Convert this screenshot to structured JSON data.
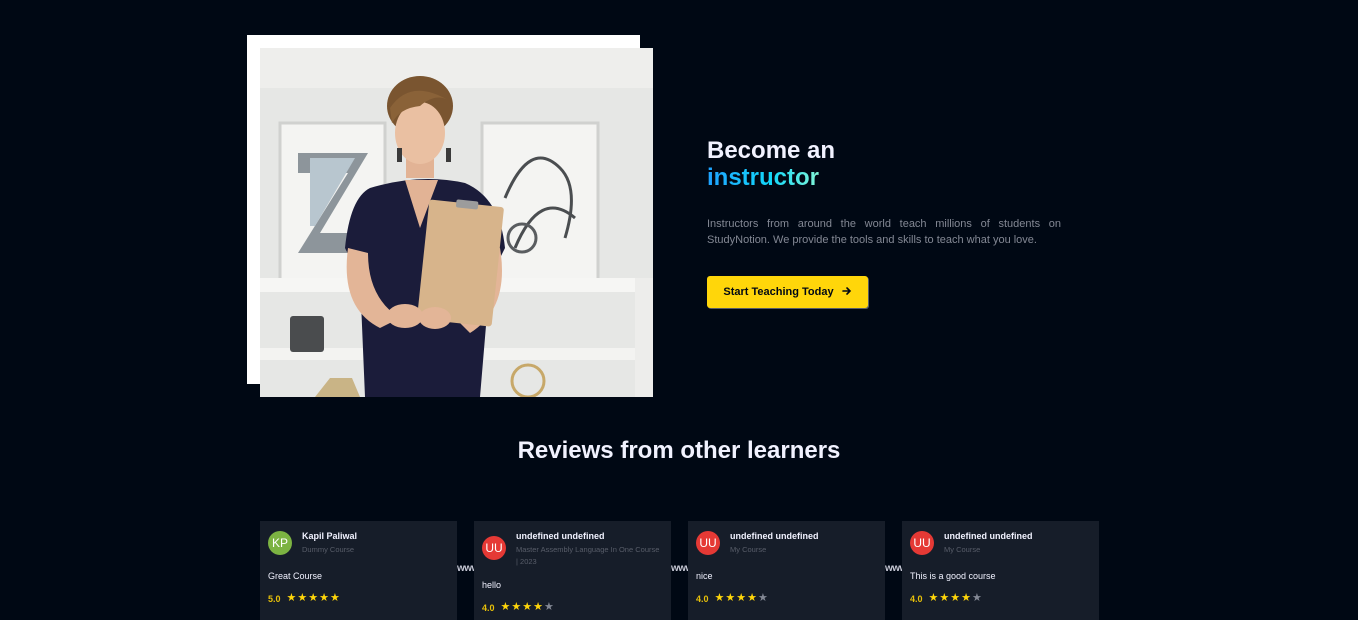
{
  "instructor": {
    "title_line1": "Become an",
    "title_line2": "instructor",
    "description": "Instructors from around the world teach millions of students on StudyNotion. We provide the tools and skills to teach what you love.",
    "cta_label": "Start Teaching Today",
    "cta_icon": "arrow-right-icon",
    "accent_color": "#ffd60a"
  },
  "reviews": {
    "title": "Reviews from other learners",
    "separator_text": "www",
    "items": [
      {
        "initials": "KP",
        "avatar_color": "#7cb342",
        "name": "Kapil Paliwal",
        "course": "Dummy Course",
        "text": "Great Course",
        "score": "5.0",
        "stars": 5
      },
      {
        "initials": "UU",
        "avatar_color": "#e53935",
        "name": "undefined undefined",
        "course": "Master Assembly Language In One Course | 2023",
        "text": "hello",
        "score": "4.0",
        "stars": 4
      },
      {
        "initials": "UU",
        "avatar_color": "#e53935",
        "name": "undefined undefined",
        "course": "My Course",
        "text": "nice",
        "score": "4.0",
        "stars": 4
      },
      {
        "initials": "UU",
        "avatar_color": "#e53935",
        "name": "undefined undefined",
        "course": "My Course",
        "text": "This is a good course",
        "score": "4.0",
        "stars": 4
      }
    ]
  }
}
